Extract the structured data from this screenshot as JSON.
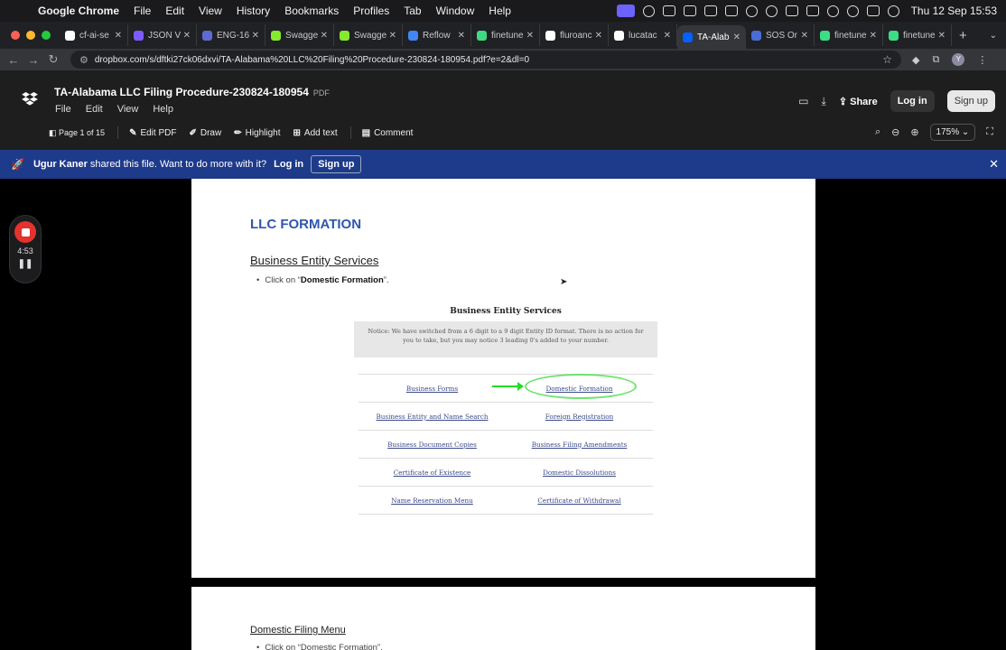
{
  "menubar": {
    "app": "Google Chrome",
    "items": [
      "File",
      "Edit",
      "View",
      "History",
      "Bookmarks",
      "Profiles",
      "Tab",
      "Window",
      "Help"
    ],
    "clock": "Thu 12 Sep  15:53"
  },
  "tabs": [
    {
      "label": "cf-ai-se",
      "color": "#ffffff"
    },
    {
      "label": "JSON V",
      "color": "#7c5cff"
    },
    {
      "label": "ENG-16",
      "color": "#5e6ad2"
    },
    {
      "label": "Swagge",
      "color": "#85ea2d"
    },
    {
      "label": "Swagge",
      "color": "#85ea2d"
    },
    {
      "label": "Reflow",
      "color": "#4285f4"
    },
    {
      "label": "finetune",
      "color": "#3ddc84"
    },
    {
      "label": "fluroanc",
      "color": "#ffffff"
    },
    {
      "label": "lucatac",
      "color": "#ffffff"
    },
    {
      "label": "TA-Alab",
      "color": "#0061ff"
    },
    {
      "label": "SOS Or",
      "color": "#4a6cd4"
    },
    {
      "label": "finetune",
      "color": "#3ddc84"
    },
    {
      "label": "finetune",
      "color": "#3ddc84"
    }
  ],
  "active_tab_index": 9,
  "address": {
    "url": "dropbox.com/s/dftki27ck06dxvi/TA-Alabama%20LLC%20Filing%20Procedure-230824-180954.pdf?e=2&dl=0"
  },
  "dropbox": {
    "title": "TA-Alabama LLC Filing Procedure-230824-180954",
    "badge": "PDF",
    "menu": [
      "File",
      "Edit",
      "View",
      "Help"
    ],
    "share": "Share",
    "login": "Log in",
    "signup": "Sign up",
    "page_indicator": "Page 1 of 15",
    "tools": [
      "Edit PDF",
      "Draw",
      "Highlight",
      "Add text",
      "Comment"
    ],
    "zoom": "175%"
  },
  "banner": {
    "user": "Ugur Kaner",
    "message": " shared this file. Want to do more with it?",
    "login": "Log in",
    "signup": "Sign up"
  },
  "recorder": {
    "time": "4:53"
  },
  "pdf": {
    "heading": "LLC FORMATION",
    "section": "Business Entity Services",
    "bullet_prefix": "Click on “",
    "bullet_bold": "Domestic Formation",
    "bullet_suffix": "”.",
    "embedded": {
      "title": "Business Entity Services",
      "notice": "Notice: We have switched from a 6 digit to a 9 digit Entity ID format. There is no action for you to take, but you may notice 3 leading 0's added to your number.",
      "links": [
        [
          "Business Forms",
          "Domestic Formation"
        ],
        [
          "Business Entity and Name Search",
          "Foreign Registration"
        ],
        [
          "Business Document Copies",
          "Business Filing Amendments"
        ],
        [
          "Certificate of Existence",
          "Domestic Dissolutions"
        ],
        [
          "Name Reservation Menu",
          "Certificate of Withdrawal"
        ]
      ]
    },
    "page2_heading": "Domestic Filing Menu",
    "page2_bullet": "Click on “Domestic Formation”."
  }
}
